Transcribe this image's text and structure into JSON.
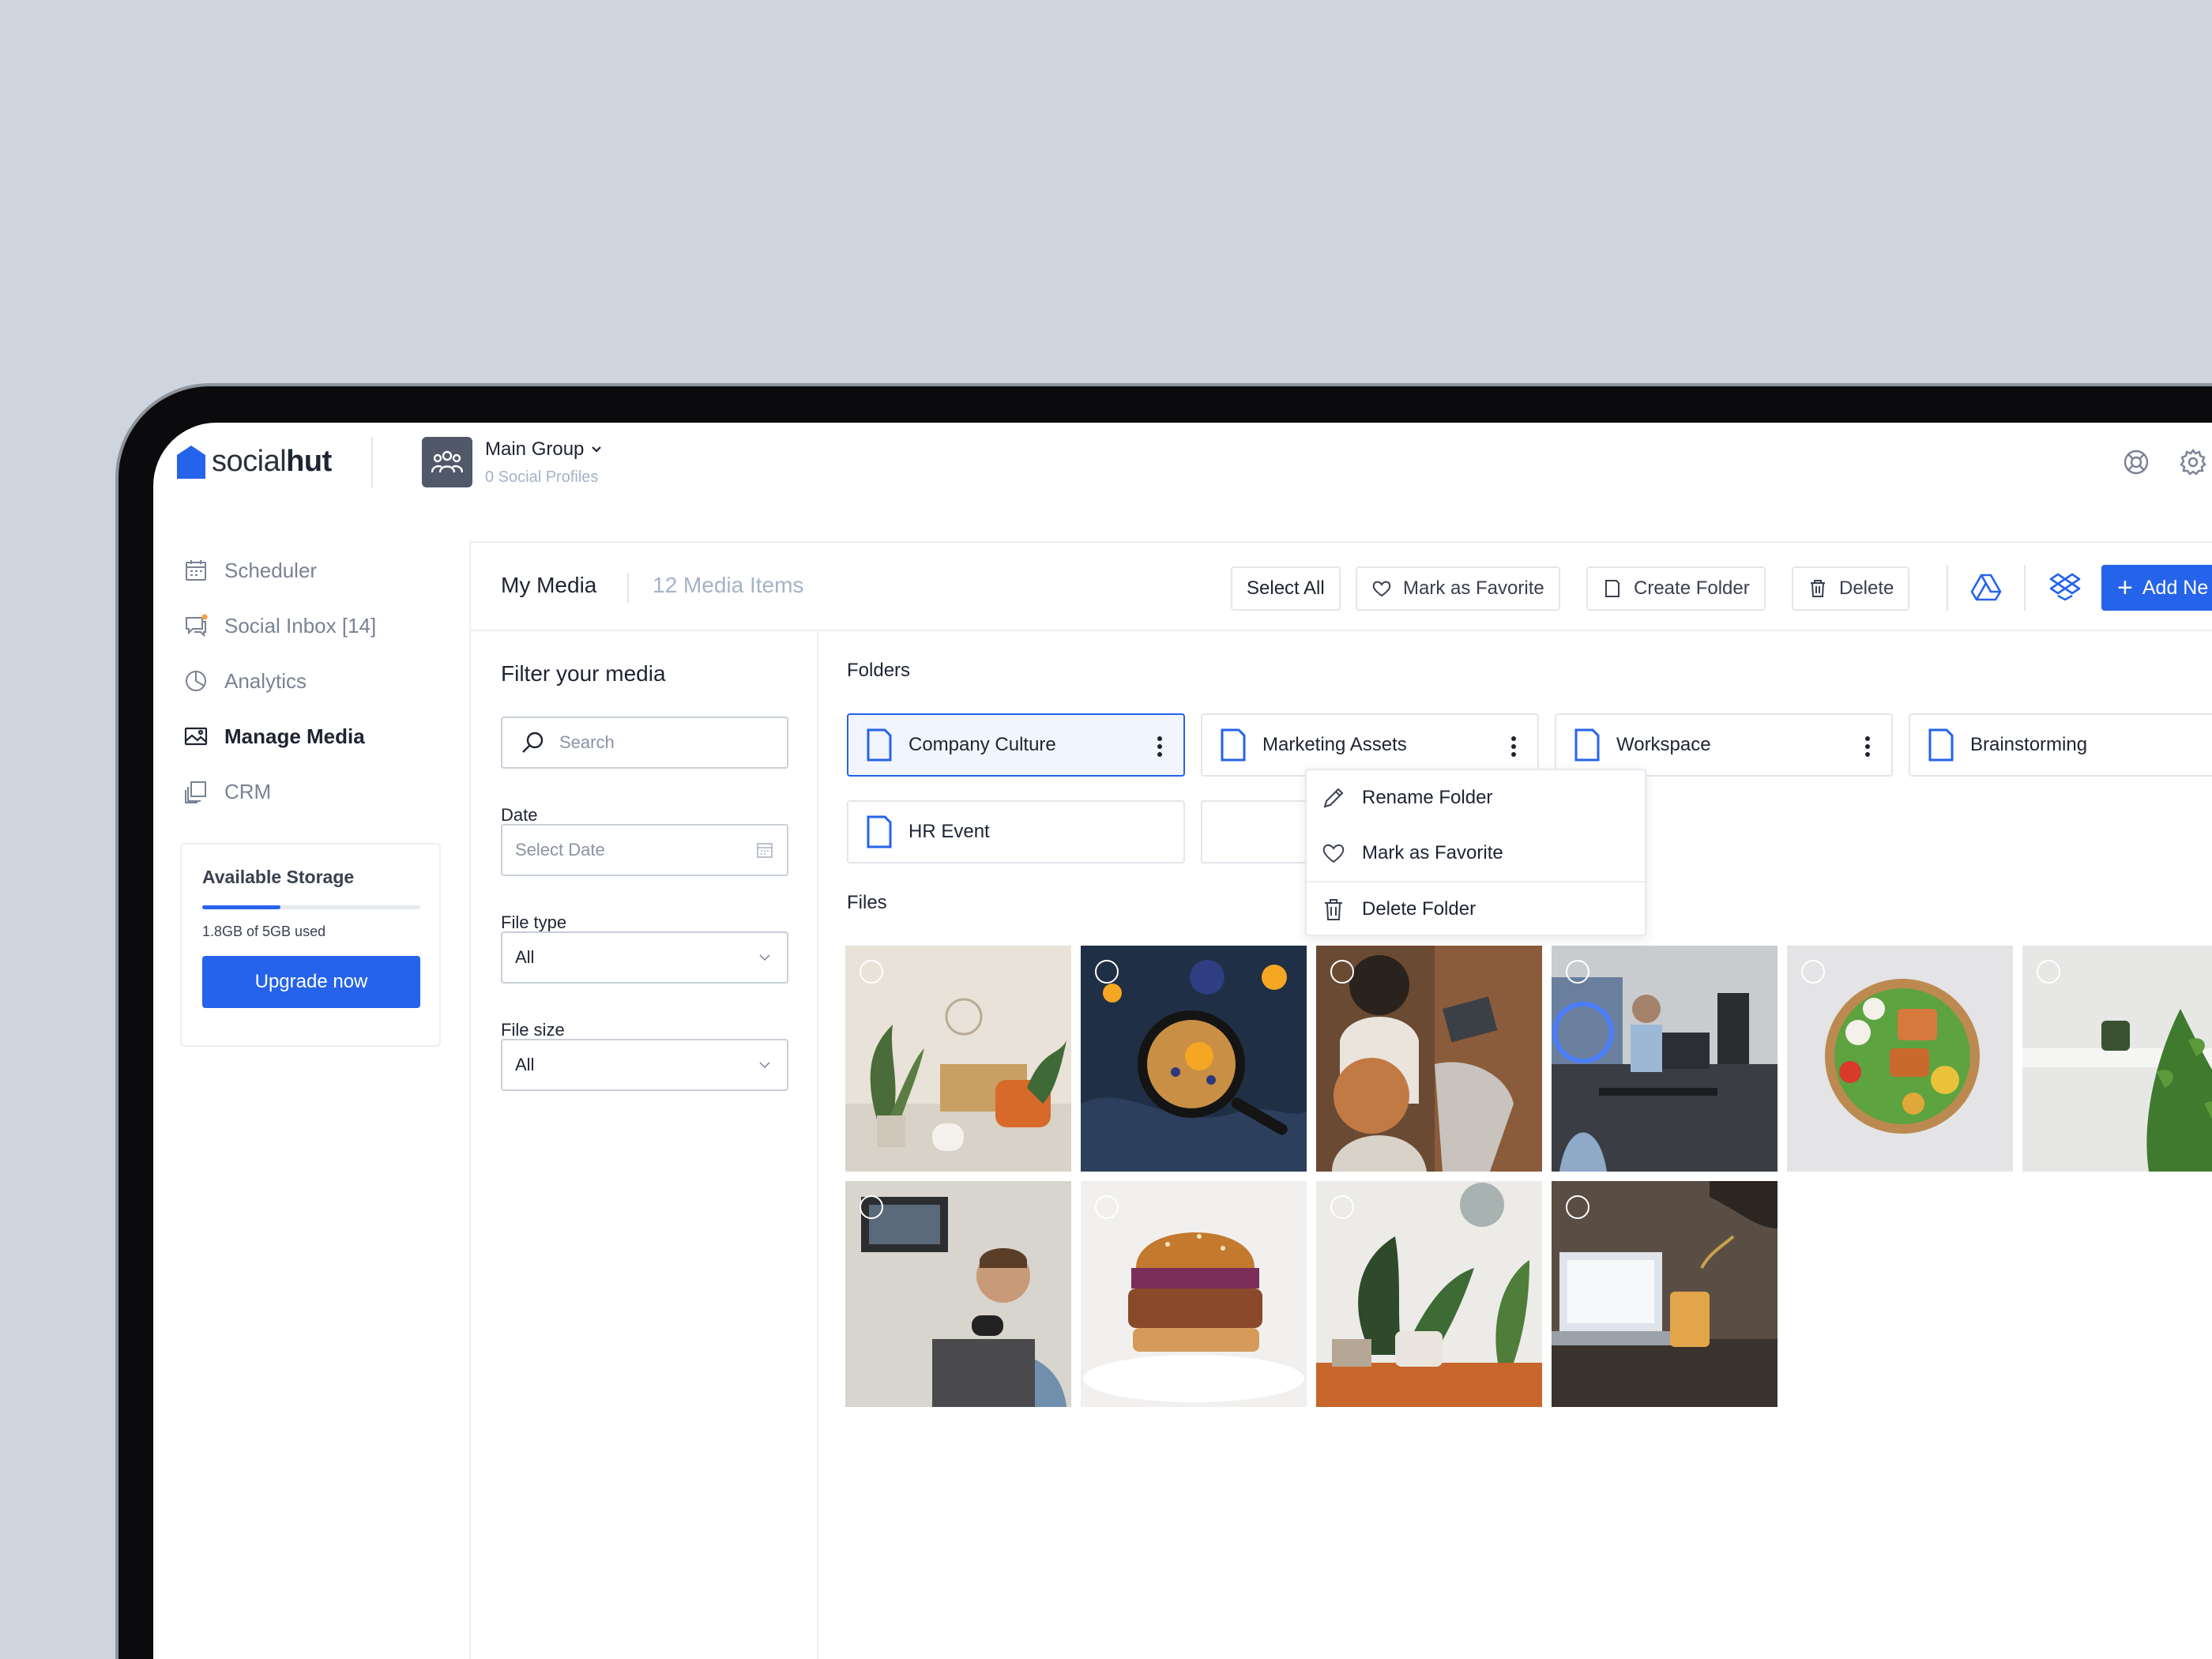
{
  "app": {
    "logo_light": "social",
    "logo_bold": "hut",
    "group_name": "Main Group",
    "group_profiles": "0 Social Profiles"
  },
  "sidebar": {
    "items": [
      {
        "label": "Scheduler",
        "icon": "calendar-icon"
      },
      {
        "label": "Social Inbox [14]",
        "icon": "chat-icon"
      },
      {
        "label": "Analytics",
        "icon": "pie-chart-icon"
      },
      {
        "label": "Manage Media",
        "icon": "image-icon"
      },
      {
        "label": "CRM",
        "icon": "copy-icon"
      }
    ],
    "storage": {
      "title": "Available Storage",
      "used_label": "1.8GB of 5GB used",
      "used_fraction": 0.36,
      "upgrade_label": "Upgrade now"
    }
  },
  "header": {
    "title": "My Media",
    "count": "12 Media Items",
    "select_all": "Select All",
    "mark_favorite": "Mark as Favorite",
    "create_folder": "Create Folder",
    "delete": "Delete",
    "add_new": "Add Ne"
  },
  "filters": {
    "title": "Filter your media",
    "search_placeholder": "Search",
    "date_label": "Date",
    "date_placeholder": "Select Date",
    "file_type_label": "File type",
    "file_type_value": "All",
    "file_size_label": "File size",
    "file_size_value": "All"
  },
  "folders": {
    "label": "Folders",
    "items": [
      "Company Culture",
      "Marketing Assets",
      "Workspace",
      "Brainstorming",
      "HR Event"
    ]
  },
  "context_menu": {
    "rename": "Rename Folder",
    "favorite": "Mark as Favorite",
    "delete": "Delete Folder"
  },
  "files": {
    "label": "Files"
  },
  "colors": {
    "accent": "#2563eb",
    "background": "#cfd5de"
  }
}
